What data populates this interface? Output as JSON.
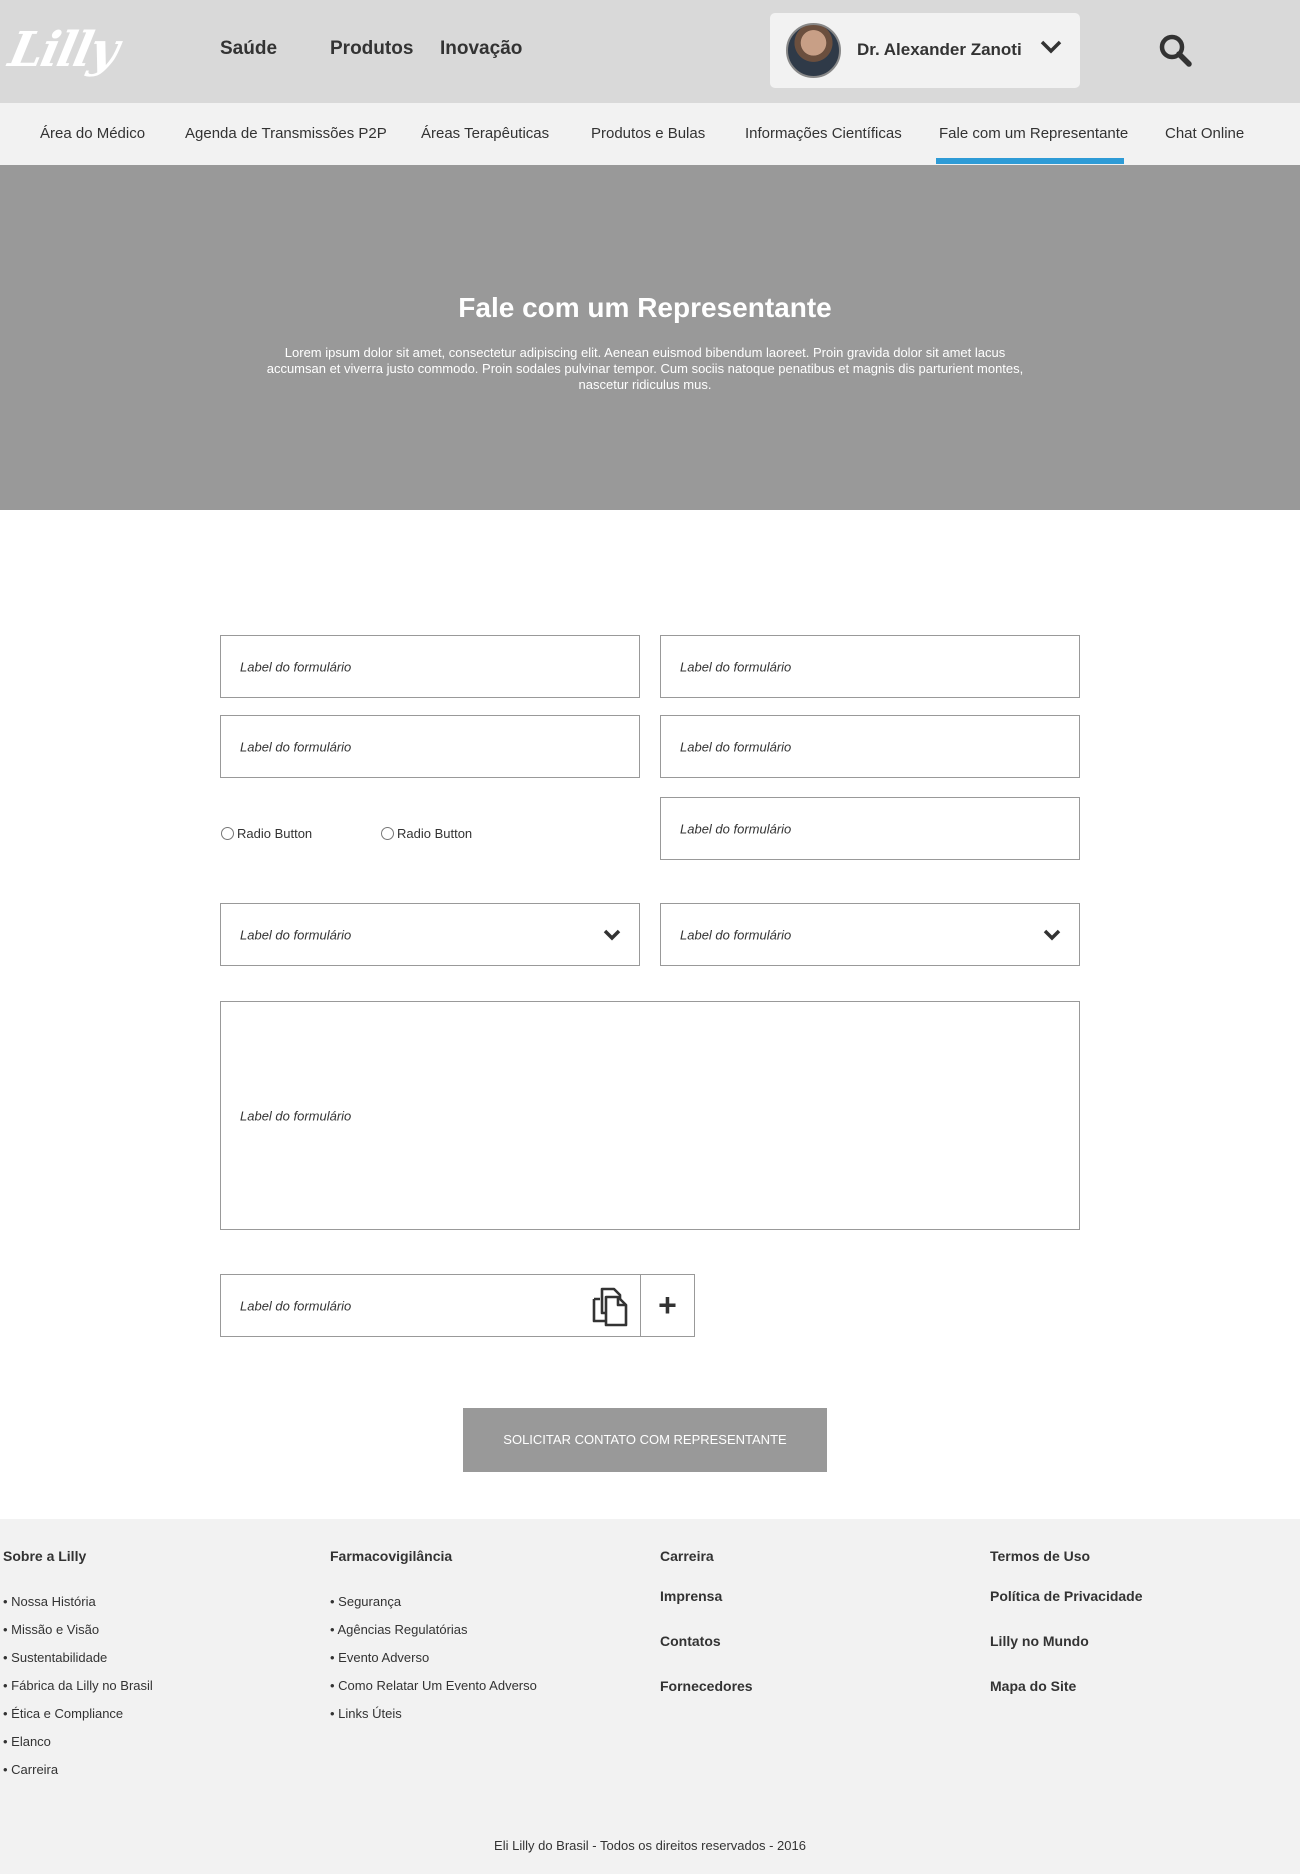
{
  "header": {
    "logo_text": "Lilly",
    "nav": [
      "Saúde",
      "Produtos",
      "Inovação"
    ],
    "user_name": "Dr. Alexander Zanoti"
  },
  "subnav": {
    "items": [
      "Área do Médico",
      "Agenda de Transmissões P2P",
      "Áreas Terapêuticas",
      "Produtos e Bulas",
      "Informações Científicas",
      "Fale com um Representante",
      "Chat Online"
    ],
    "active_index": 5
  },
  "hero": {
    "title": "Fale com um Representante",
    "text": "Lorem ipsum dolor sit amet, consectetur adipiscing elit. Aenean euismod bibendum laoreet. Proin gravida dolor sit amet lacus accumsan et viverra justo commodo. Proin sodales pulvinar tempor. Cum sociis natoque penatibus et magnis dis parturient montes, nascetur ridiculus mus."
  },
  "form": {
    "field_label": "Label do formulário",
    "radio_1": "Radio Button",
    "radio_2": "Radio Button",
    "submit_label": "SOLICITAR CONTATO COM REPRESENTANTE"
  },
  "footer": {
    "col1": {
      "title": "Sobre a Lilly",
      "links": [
        "• Nossa História",
        "• Missão e Visão",
        "• Sustentabilidade",
        "• Fábrica da Lilly no Brasil",
        "• Ética e Compliance",
        "• Elanco",
        "• Carreira"
      ]
    },
    "col2": {
      "title": "Farmacovigilância",
      "links": [
        "• Segurança",
        "• Agências Regulatórias",
        "• Evento Adverso",
        "• Como Relatar Um Evento Adverso",
        "• Links Úteis"
      ]
    },
    "col3": [
      "Carreira",
      "Imprensa",
      "Contatos",
      "Fornecedores"
    ],
    "col4": [
      "Termos de Uso",
      "Política de Privacidade",
      "Lilly no Mundo",
      "Mapa do Site"
    ],
    "copyright": "Eli Lilly do Brasil - Todos os direitos reservados - 2016"
  },
  "colors": {
    "active_tab": "#2e9bd6",
    "hero_bg": "#999999",
    "header_bg": "#d9d9d9"
  }
}
